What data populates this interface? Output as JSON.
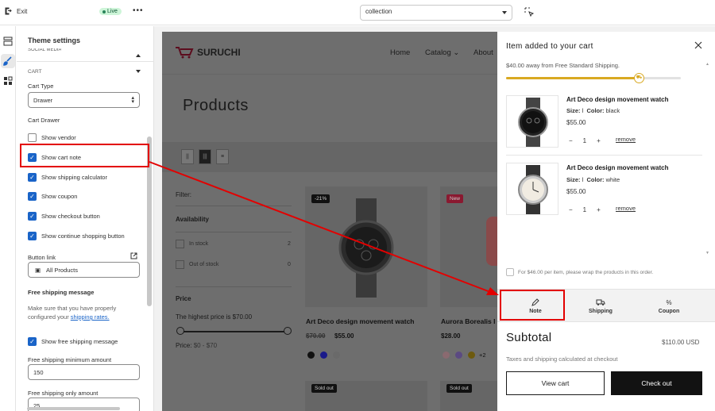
{
  "topbar": {
    "exit_label": "Exit",
    "live_label": "Live",
    "more_label": "•••",
    "template_select": "collection"
  },
  "sidebar": {
    "title": "Theme settings",
    "collapsed_section": "SOCIAL MEDIA",
    "section": "CART",
    "cart_type_label": "Cart Type",
    "cart_type_value": "Drawer",
    "cart_drawer_label": "Cart Drawer",
    "checkboxes": [
      {
        "label": "Show vendor",
        "checked": false
      },
      {
        "label": "Show cart note",
        "checked": true
      },
      {
        "label": "Show shipping calculator",
        "checked": true
      },
      {
        "label": "Show coupon",
        "checked": true
      },
      {
        "label": "Show checkout button",
        "checked": true
      },
      {
        "label": "Show continue shopping button",
        "checked": true
      }
    ],
    "button_link_label": "Button link",
    "button_link_value": "All Products",
    "free_shipping_heading": "Free shipping message",
    "free_shipping_help_1": "Make sure that you have properly",
    "free_shipping_help_2": "configured your",
    "free_shipping_help_link": "shipping rates.",
    "show_free_shipping": "Show free shipping message",
    "min_amount_label": "Free shipping minimum amount",
    "min_amount_value": "150",
    "only_amount_label": "Free shipping only amount",
    "only_amount_value": "25"
  },
  "store": {
    "logo": "SURUCHI",
    "nav": [
      "Home",
      "Catalog",
      "About"
    ],
    "page_title": "Products",
    "filter_label": "Filter:",
    "availability_label": "Availability",
    "availability_options": [
      {
        "label": "In stock",
        "count": "2"
      },
      {
        "label": "Out of stock",
        "count": "0"
      }
    ],
    "price_label": "Price",
    "price_text": "The highest price is $70.00",
    "price_range_label": "Price:",
    "price_range_value": "$0 - $70",
    "products": [
      {
        "badge": "-21%",
        "name": "Art Deco design movement watch",
        "old_price": "$70.00",
        "price": "$55.00"
      },
      {
        "badge": "New",
        "name": "Aurora Borealis I",
        "price": "$28.00",
        "more_swatches": "+2"
      }
    ],
    "sold_out": "Sold out"
  },
  "drawer": {
    "title": "Item added to your cart",
    "shipping_message": "$40.00 away from Free Standard Shipping.",
    "shipping_progress_pct": 76,
    "items": [
      {
        "name": "Art Deco design movement watch",
        "size_label": "Size:",
        "size": "l",
        "color_label": "Color:",
        "color": "black",
        "price": "$55.00",
        "qty": "1",
        "remove": "remove"
      },
      {
        "name": "Art Deco design movement watch",
        "size_label": "Size:",
        "size": "l",
        "color_label": "Color:",
        "color": "white",
        "price": "$55.00",
        "qty": "1",
        "remove": "remove"
      }
    ],
    "gift_wrap": "For $46.00 per item, please wrap the products in this order.",
    "tabs": [
      "Note",
      "Shipping",
      "Coupon"
    ],
    "subtotal_label": "Subtotal",
    "subtotal_value": "$110.00 USD",
    "tax_note": "Taxes and shipping calculated at checkout",
    "view_cart": "View cart",
    "checkout": "Check out"
  }
}
